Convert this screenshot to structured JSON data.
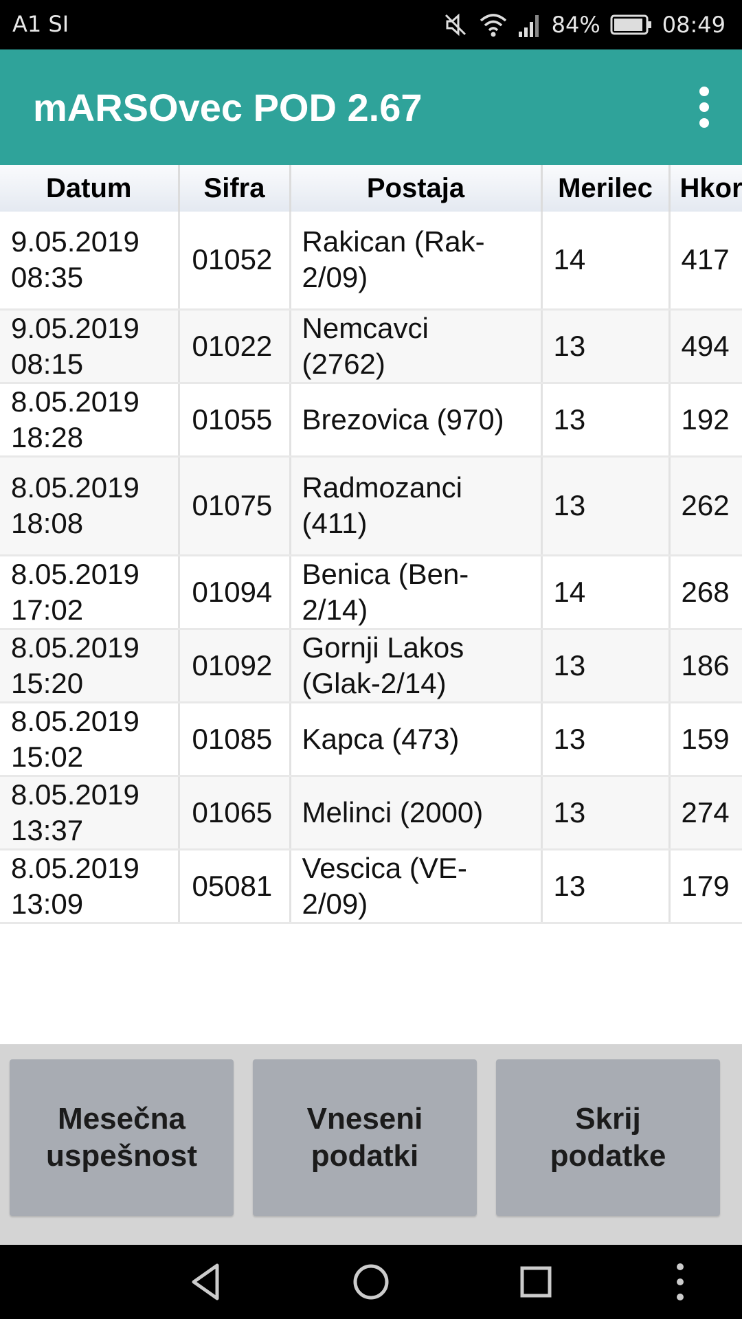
{
  "status_bar": {
    "carrier": "A1 SI",
    "battery": "84%",
    "time": "08:49",
    "icons": [
      "mute-icon",
      "wifi-icon",
      "signal-icon",
      "battery-icon"
    ]
  },
  "app_bar": {
    "title": "mARSOvec POD 2.67",
    "menu_icon": "more-vert-icon",
    "color": "#2fa39a"
  },
  "table": {
    "columns": [
      "Datum",
      "Sifra",
      "Postaja",
      "Merilec",
      "Hkor"
    ],
    "rows": [
      {
        "date": "9.05.2019",
        "time": "08:35",
        "sifra": "01052",
        "postaja_1": "Rakican (Rak-",
        "postaja_2": "2/09)",
        "merilec": "14",
        "hkor": "417"
      },
      {
        "date": "9.05.2019",
        "time": "08:15",
        "sifra": "01022",
        "postaja_1": "Nemcavci",
        "postaja_2": "(2762)",
        "merilec": "13",
        "hkor": "494"
      },
      {
        "date": "8.05.2019",
        "time": "18:28",
        "sifra": "01055",
        "postaja_1": "Brezovica (970)",
        "postaja_2": "",
        "merilec": "13",
        "hkor": "192"
      },
      {
        "date": "8.05.2019",
        "time": "18:08",
        "sifra": "01075",
        "postaja_1": "Radmozanci",
        "postaja_2": "(411)",
        "merilec": "13",
        "hkor": "262"
      },
      {
        "date": "8.05.2019",
        "time": "17:02",
        "sifra": "01094",
        "postaja_1": "Benica (Ben-",
        "postaja_2": "2/14)",
        "merilec": "14",
        "hkor": "268"
      },
      {
        "date": "8.05.2019",
        "time": "15:20",
        "sifra": "01092",
        "postaja_1": "Gornji Lakos",
        "postaja_2": "(Glak-2/14)",
        "merilec": "13",
        "hkor": "186"
      },
      {
        "date": "8.05.2019",
        "time": "15:02",
        "sifra": "01085",
        "postaja_1": "Kapca (473)",
        "postaja_2": "",
        "merilec": "13",
        "hkor": "159"
      },
      {
        "date": "8.05.2019",
        "time": "13:37",
        "sifra": "01065",
        "postaja_1": "Melinci (2000)",
        "postaja_2": "",
        "merilec": "13",
        "hkor": "274"
      },
      {
        "date": "8.05.2019",
        "time": "13:09",
        "sifra": "05081",
        "postaja_1": "Vescica (VE-",
        "postaja_2": "2/09)",
        "merilec": "13",
        "hkor": "179"
      }
    ]
  },
  "buttons": [
    {
      "line1": "Mesečna",
      "line2": "uspešnost"
    },
    {
      "line1": "Vneseni",
      "line2": "podatki"
    },
    {
      "line1": "Skrij",
      "line2": "podatke"
    }
  ],
  "nav_bar": {
    "icons": [
      "back-icon",
      "home-icon",
      "recents-icon",
      "more-vert-icon"
    ]
  }
}
